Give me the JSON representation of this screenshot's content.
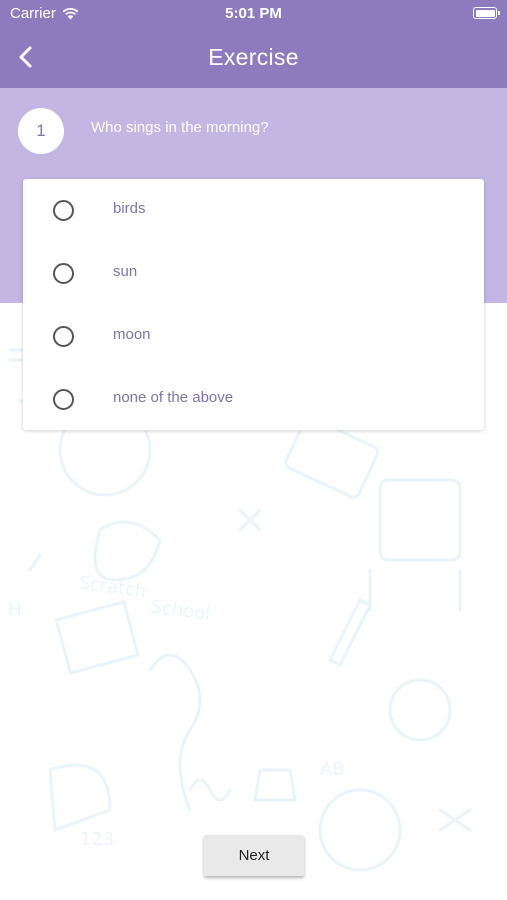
{
  "status_bar": {
    "carrier": "Carrier",
    "time": "5:01 PM"
  },
  "nav": {
    "title": "Exercise",
    "back_icon": "chevron-left-icon"
  },
  "question": {
    "number": "1",
    "text": "Who sings in the morning?"
  },
  "options": [
    {
      "label": "birds",
      "selected": false
    },
    {
      "label": "sun",
      "selected": false
    },
    {
      "label": "moon",
      "selected": false
    },
    {
      "label": "none of the above",
      "selected": false
    }
  ],
  "footer": {
    "next_label": "Next"
  },
  "colors": {
    "header": "#8e7bbd",
    "band": "#c4b6e3",
    "option_text": "#7f73a9",
    "doodle": "#d9eef7"
  }
}
